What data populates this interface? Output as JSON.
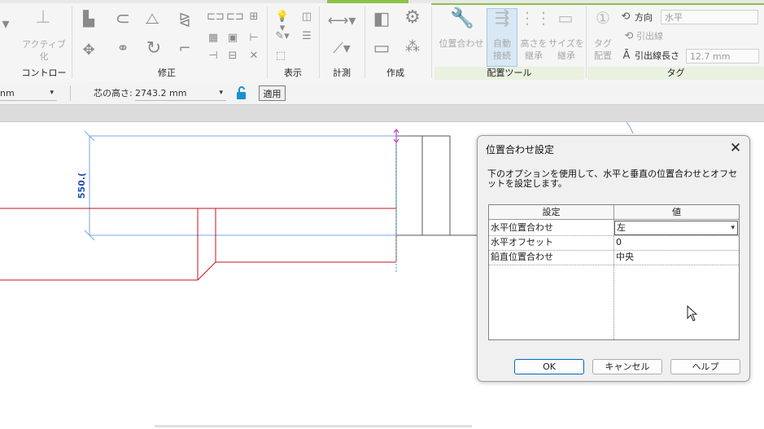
{
  "ribbon": {
    "panels": {
      "control": "コントロール",
      "modify": "修正",
      "view": "表示",
      "measure": "計測",
      "create": "作成",
      "placement_tools": "配置ツール",
      "tag": "タグ"
    },
    "activate_label": "アクティブ化",
    "placement_buttons": {
      "align": "位置合わせ",
      "auto_connect_1": "自動",
      "auto_connect_2": "接続",
      "inherit_height_1": "高さを",
      "inherit_height_2": "継承",
      "inherit_size_1": "サイズを",
      "inherit_size_2": "継承"
    },
    "tag": {
      "tag_place_1": "タグ",
      "tag_place_2": "配置",
      "orientation_label": "方向",
      "orientation_value": "水平",
      "leader_label": "引出線",
      "leader_length_label": "引出線長さ",
      "leader_length_value": "12.7 mm"
    }
  },
  "options_bar": {
    "left_value": "nm",
    "center_height_label": "芯の高さ:",
    "center_height_value": "2743.2 mm",
    "apply_button": "適用"
  },
  "canvas": {
    "dimension_text": "550.("
  },
  "dialog": {
    "title": "位置合わせ設定",
    "description": "下のオプションを使用して、水平と垂直の位置合わせとオフセットを設定します。",
    "columns": [
      "設定",
      "値"
    ],
    "rows": [
      {
        "setting": "水平位置合わせ",
        "value": "左"
      },
      {
        "setting": "水平オフセット",
        "value": "0"
      },
      {
        "setting": "鉛直位置合わせ",
        "value": "中央"
      }
    ],
    "ok": "OK",
    "cancel": "キャンセル",
    "help": "ヘルプ"
  },
  "colors": {
    "accent_green": "#8bc34a",
    "red_lines": "#c8101c",
    "blue_lines": "#7aa3e8",
    "magenta": "#c050c0",
    "dim_text": "#1d4fb0"
  }
}
